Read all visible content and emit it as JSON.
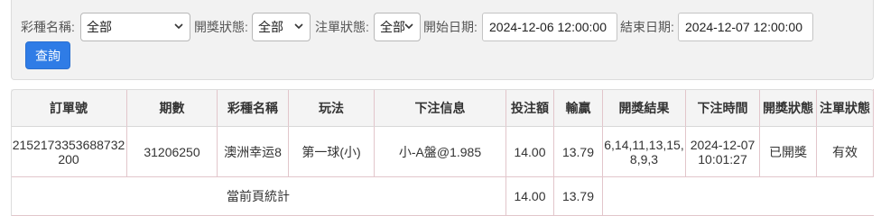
{
  "filters": {
    "lottery_label": "彩種名稱:",
    "lottery_value": "全部",
    "draw_status_label": "開獎狀態:",
    "draw_status_value": "全部",
    "bet_status_label": "注單狀態:",
    "bet_status_value": "全部",
    "start_label": "開始日期:",
    "start_value": "2024-12-06 12:00:00",
    "end_label": "結束日期:",
    "end_value": "2024-12-07 12:00:00",
    "query_label": "查詢"
  },
  "table": {
    "headers": [
      "訂單號",
      "期數",
      "彩種名稱",
      "玩法",
      "下注信息",
      "投注額",
      "輸贏",
      "開獎結果",
      "下注時間",
      "開獎狀態",
      "注單狀態"
    ],
    "rows": [
      [
        "2152173353688732200",
        "31206250",
        "澳洲幸运8",
        "第一球(小)",
        "小-A盤@1.985",
        "14.00",
        "13.79",
        "6,14,11,13,15,8,9,3",
        "2024-12-07 10:01:27",
        "已開獎",
        "有效"
      ]
    ],
    "summary": {
      "label": "當前頁統計",
      "bet_total": "14.00",
      "win_total": "13.79"
    }
  },
  "colors": {
    "accent": "#2f7ce6",
    "grid_line": "#e2c6cb",
    "header_bg": "#f4f4f4",
    "panel_bg": "#f2f2f2"
  }
}
